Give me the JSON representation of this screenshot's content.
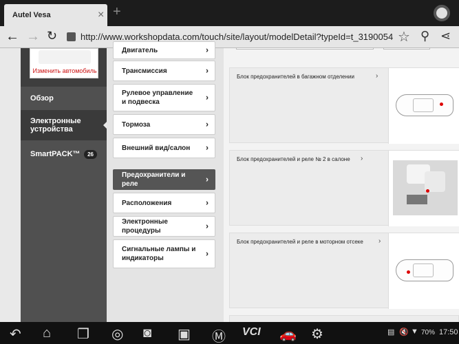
{
  "browser": {
    "tab_title": "Autel Vesa",
    "tab_close": "×",
    "new_tab": "+",
    "url": "http://www.workshopdata.com/touch/site/layout/modelDetail?typeId=t_3190054"
  },
  "sidebar": {
    "change_car": "Изменить автомобиль",
    "items": [
      {
        "label": "Обзор"
      },
      {
        "label": "Электронные устройства"
      },
      {
        "label": "SmartPACK™",
        "badge": "26"
      }
    ]
  },
  "middle_menu": {
    "items": [
      {
        "label": "Двигатель"
      },
      {
        "label": "Трансмиссия"
      },
      {
        "label": "Рулевое управление и подвеска"
      },
      {
        "label": "Тормоза"
      },
      {
        "label": "Внешний вид/салон"
      },
      {
        "label": "Предохранители и реле"
      },
      {
        "label": "Расположения"
      },
      {
        "label": "Электронные процедуры"
      },
      {
        "label": "Сигнальные лампы и индикаторы"
      }
    ],
    "chevron": "›"
  },
  "content": {
    "cards": [
      {
        "title": "Блок предохранителей в багажном отделении"
      },
      {
        "title": "Блок предохранителей и реле № 2 в салоне"
      },
      {
        "title": "Блок предохранителей и реле в моторном отсеке"
      }
    ]
  },
  "statusbar": {
    "battery": "70%",
    "time": "17:50"
  },
  "navbar": {
    "vci_label": "VCI"
  }
}
